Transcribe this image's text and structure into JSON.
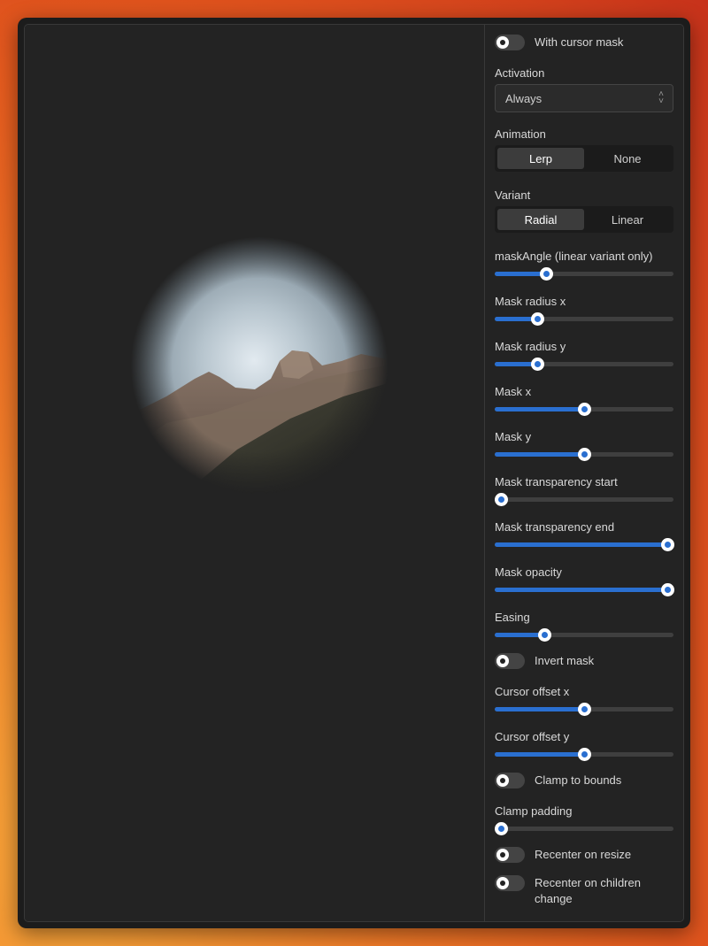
{
  "controls": {
    "with_cursor_mask": {
      "label": "With cursor mask",
      "on": false
    },
    "activation": {
      "label": "Activation",
      "value": "Always"
    },
    "animation": {
      "label": "Animation",
      "options": [
        "Lerp",
        "None"
      ],
      "selected": "Lerp"
    },
    "variant": {
      "label": "Variant",
      "options": [
        "Radial",
        "Linear"
      ],
      "selected": "Radial"
    },
    "sliders": [
      {
        "label": "maskAngle (linear variant only)",
        "value": 0.27
      },
      {
        "label": "Mask radius x",
        "value": 0.22
      },
      {
        "label": "Mask radius y",
        "value": 0.22
      },
      {
        "label": "Mask x",
        "value": 0.5
      },
      {
        "label": "Mask y",
        "value": 0.5
      },
      {
        "label": "Mask transparency start",
        "value": 0.0
      },
      {
        "label": "Mask transparency end",
        "value": 1.0
      },
      {
        "label": "Mask opacity",
        "value": 1.0
      },
      {
        "label": "Easing",
        "value": 0.26
      }
    ],
    "invert_mask": {
      "label": "Invert mask",
      "on": false
    },
    "cursor_sliders": [
      {
        "label": "Cursor offset x",
        "value": 0.5
      },
      {
        "label": "Cursor offset y",
        "value": 0.5
      }
    ],
    "clamp_to_bounds": {
      "label": "Clamp to bounds",
      "on": false
    },
    "clamp_padding": {
      "label": "Clamp padding",
      "value": 0.0
    },
    "recenter_on_resize": {
      "label": "Recenter on resize",
      "on": false
    },
    "recenter_on_children_change": {
      "label": "Recenter on children change",
      "on": false
    }
  },
  "colors": {
    "accent": "#2a6fd0",
    "panel": "#232323",
    "track": "#3f3f3f"
  },
  "icons": {
    "select_chevron": "chevron-up-down-icon"
  }
}
